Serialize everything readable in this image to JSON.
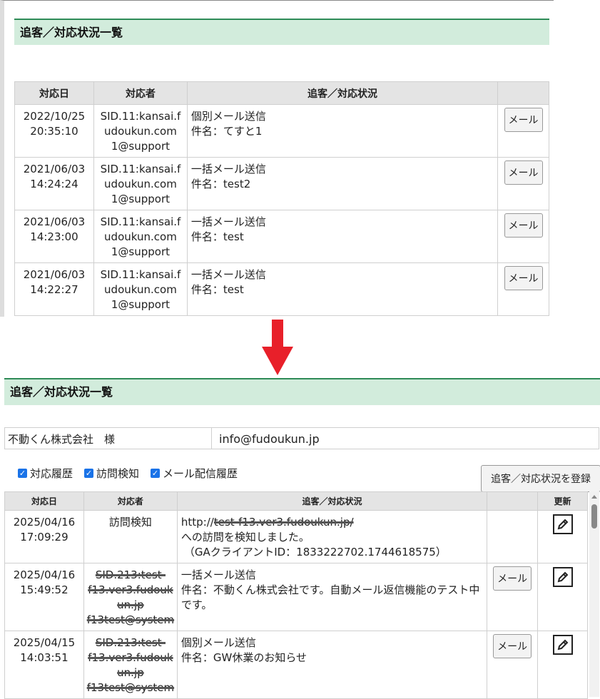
{
  "top": {
    "title": "追客／対応状況一覧",
    "headers": [
      "対応日",
      "対応者",
      "追客／対応状況",
      ""
    ],
    "rows": [
      {
        "date": "2022/10/25",
        "time": "20:35:10",
        "person": [
          "SID.11:kansai.f",
          "udoukun.com",
          "1@support"
        ],
        "status": [
          "個別メール送信",
          "件名：てすと1"
        ],
        "button": "メール"
      },
      {
        "date": "2021/06/03",
        "time": "14:24:24",
        "person": [
          "SID.11:kansai.f",
          "udoukun.com",
          "1@support"
        ],
        "status": [
          "一括メール送信",
          "件名：test2"
        ],
        "button": "メール"
      },
      {
        "date": "2021/06/03",
        "time": "14:23:00",
        "person": [
          "SID.11:kansai.f",
          "udoukun.com",
          "1@support"
        ],
        "status": [
          "一括メール送信",
          "件名：test"
        ],
        "button": "メール"
      },
      {
        "date": "2021/06/03",
        "time": "14:22:27",
        "person": [
          "SID.11:kansai.f",
          "udoukun.com",
          "1@support"
        ],
        "status": [
          "一括メール送信",
          "件名：test"
        ],
        "button": "メール"
      }
    ]
  },
  "arrow": {
    "color": "#e8202a"
  },
  "bottom": {
    "title": "追客／対応状況一覧",
    "customer": {
      "name": "不動くん株式会社　様",
      "email": "info@fudoukun.jp"
    },
    "filters": [
      "対応履歴",
      "訪問検知",
      "メール配信履歴"
    ],
    "register_button": "追客／対応状況を登録",
    "headers": [
      "対応日",
      "対応者",
      "追客／対応状況",
      "",
      "更新"
    ],
    "rows": [
      {
        "date": "2025/04/16",
        "time": "17:09:29",
        "person": [
          "訪問検知"
        ],
        "person_struck": false,
        "status": [
          "http://test-f13.ver3.fudoukun.jp/",
          "への訪問を検知しました。",
          "（GAクライアントID：1833222702.1744618575）"
        ],
        "button": ""
      },
      {
        "date": "2025/04/16",
        "time": "15:49:52",
        "person": [
          "SID.213:test-",
          "f13.ver3.fudouk",
          "un.jp",
          "f13test@system"
        ],
        "person_struck": true,
        "status": [
          "一括メール送信",
          "件名：不動くん株式会社です。自動メール返信機能のテスト中",
          "です。"
        ],
        "button": "メール"
      },
      {
        "date": "2025/04/15",
        "time": "14:03:51",
        "person": [
          "SID.213:test-",
          "f13.ver3.fudouk",
          "un.jp",
          "f13test@system"
        ],
        "person_struck": true,
        "status": [
          "個別メール送信",
          "件名：GW休業のお知らせ"
        ],
        "button": "メール"
      }
    ]
  }
}
